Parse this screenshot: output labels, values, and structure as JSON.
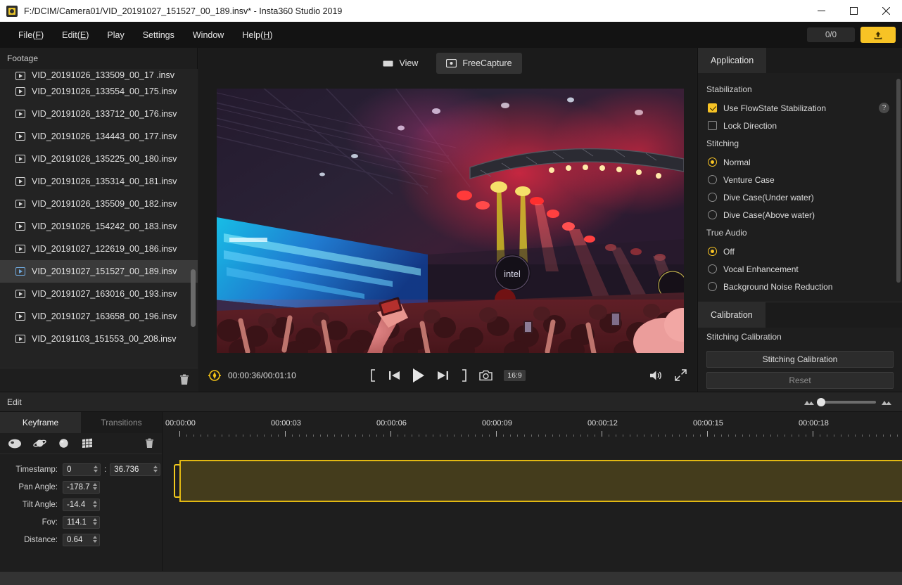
{
  "window": {
    "title": "F:/DCIM/Camera01/VID_20191027_151527_00_189.insv* - Insta360 Studio 2019",
    "app_icon": "app-icon",
    "minimize": "minimize-icon",
    "maximize": "maximize-icon",
    "close": "close-icon"
  },
  "menu": {
    "items": [
      {
        "label": "File",
        "accel": "F"
      },
      {
        "label": "Edit",
        "accel": "E"
      },
      {
        "label": "Play",
        "accel": ""
      },
      {
        "label": "Settings",
        "accel": ""
      },
      {
        "label": "Window",
        "accel": ""
      },
      {
        "label": "Help",
        "accel": "H"
      }
    ],
    "counter": "0/0",
    "export_icon": "export-upload-icon"
  },
  "footage": {
    "header": "Footage",
    "partial_top": "VID_20191026_133509_00_17 .insv",
    "items": [
      {
        "name": "VID_20191026_133554_00_175.insv",
        "selected": false
      },
      {
        "name": "VID_20191026_133712_00_176.insv",
        "selected": false
      },
      {
        "name": "VID_20191026_134443_00_177.insv",
        "selected": false
      },
      {
        "name": "VID_20191026_135225_00_180.insv",
        "selected": false
      },
      {
        "name": "VID_20191026_135314_00_181.insv",
        "selected": false
      },
      {
        "name": "VID_20191026_135509_00_182.insv",
        "selected": false
      },
      {
        "name": "VID_20191026_154242_00_183.insv",
        "selected": false
      },
      {
        "name": "VID_20191027_122619_00_186.insv",
        "selected": false
      },
      {
        "name": "VID_20191027_151527_00_189.insv",
        "selected": true
      },
      {
        "name": "VID_20191027_163016_00_193.insv",
        "selected": false
      },
      {
        "name": "VID_20191027_163658_00_196.insv",
        "selected": false
      },
      {
        "name": "VID_20191103_151553_00_208.insv",
        "selected": false
      }
    ],
    "delete_icon": "trash-icon"
  },
  "preview": {
    "tabs": [
      {
        "label": "View",
        "icon": "view-rect-icon",
        "active": false
      },
      {
        "label": "FreeCapture",
        "icon": "freecapture-icon",
        "active": true
      }
    ],
    "controls": {
      "target_icon": "recenter-target-icon",
      "timecode": "00:00:36/00:01:10",
      "mark_in": "mark-in-icon",
      "prev_frame": "previous-frame-icon",
      "play": "play-icon",
      "next_frame": "next-frame-icon",
      "mark_out": "mark-out-icon",
      "snapshot": "camera-snapshot-icon",
      "aspect_ratio": "16:9",
      "volume": "volume-icon",
      "fullscreen": "fullscreen-icon"
    }
  },
  "settings": {
    "application_tab": "Application",
    "stabilization": {
      "title": "Stabilization",
      "flowstate": {
        "label": "Use FlowState Stabilization",
        "checked": true
      },
      "lock_direction": {
        "label": "Lock Direction",
        "checked": false
      },
      "help_icon": "help-question-icon",
      "help_glyph": "?"
    },
    "stitching": {
      "title": "Stitching",
      "options": [
        {
          "label": "Normal",
          "selected": true
        },
        {
          "label": "Venture Case",
          "selected": false
        },
        {
          "label": "Dive Case(Under water)",
          "selected": false
        },
        {
          "label": "Dive Case(Above water)",
          "selected": false
        }
      ]
    },
    "true_audio": {
      "title": "True Audio",
      "options": [
        {
          "label": "Off",
          "selected": true
        },
        {
          "label": "Vocal Enhancement",
          "selected": false
        },
        {
          "label": "Background Noise Reduction",
          "selected": false
        }
      ]
    },
    "calibration_tab": "Calibration",
    "calibration": {
      "title": "Stitching Calibration",
      "calibrate_button": "Stitching Calibration",
      "reset_button": "Reset"
    },
    "accent_color": "#f7c325"
  },
  "edit": {
    "label": "Edit",
    "zoom_out_icon": "zoom-out-icon",
    "zoom_in_icon": "zoom-in-icon"
  },
  "keyframe": {
    "tabs": [
      {
        "label": "Keyframe",
        "active": true
      },
      {
        "label": "Transitions",
        "active": false
      }
    ],
    "tools": [
      "fisheye-view-icon",
      "planet-view-icon",
      "sphere-view-icon",
      "perspective-grid-icon"
    ],
    "delete_icon": "trash-icon",
    "fields": [
      {
        "label": "Timestamp:",
        "value": "0",
        "value2": "36.736",
        "separator": ":"
      },
      {
        "label": "Pan Angle:",
        "value": "-178.7"
      },
      {
        "label": "Tilt Angle:",
        "value": "-14.4"
      },
      {
        "label": "Fov:",
        "value": "114.1"
      },
      {
        "label": "Distance:",
        "value": "0.64"
      }
    ]
  },
  "timeline": {
    "ruler_labels": [
      "00:00:00",
      "00:00:03",
      "00:00:06",
      "00:00:09",
      "00:00:12",
      "00:00:15",
      "00:00:18"
    ],
    "clip_color": "#443c1c",
    "clip_border_color": "#e3b912"
  }
}
